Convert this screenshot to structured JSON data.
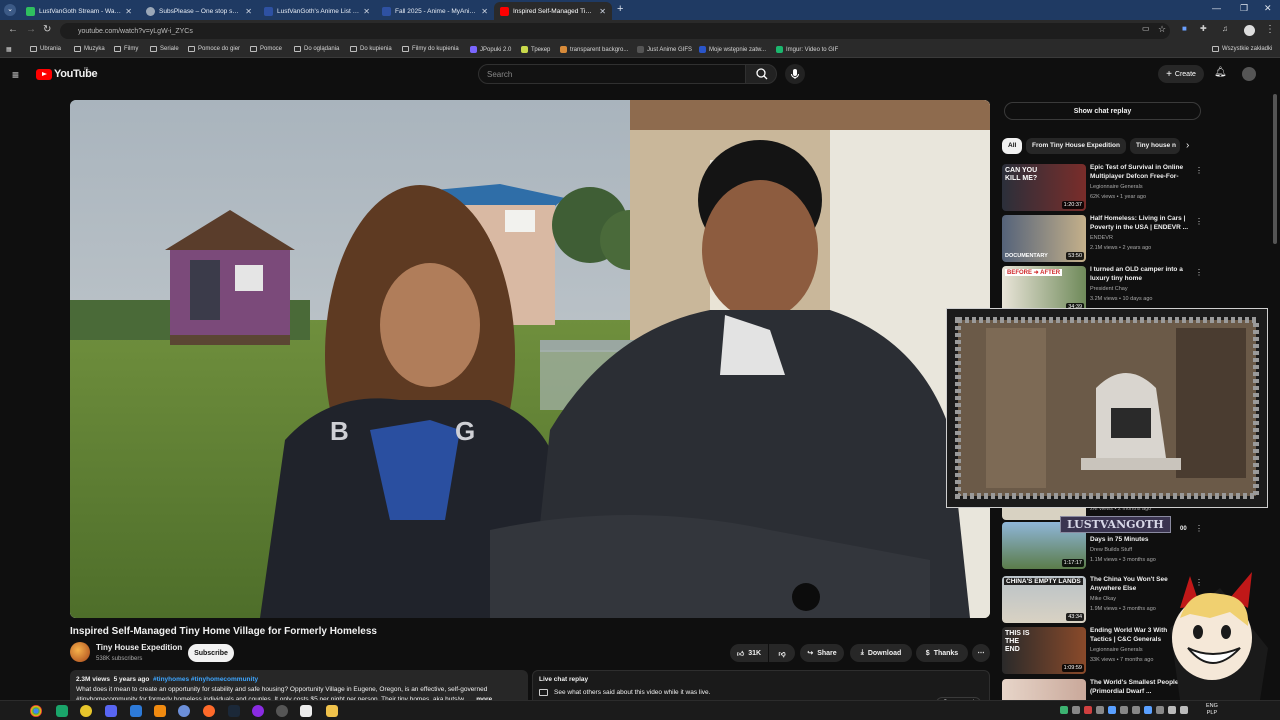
{
  "browser": {
    "tabs": [
      {
        "label": "LustVanGoth Stream - Watch L",
        "active": false,
        "favicon_color": "#2fbf5f"
      },
      {
        "label": "SubsPlease – One stop shop fo",
        "active": false,
        "favicon_color": "#9aa7b7"
      },
      {
        "label": "LustVanGoth's Anime List - My",
        "active": false,
        "favicon_color": "#2e51a2"
      },
      {
        "label": "Fall 2025 - Anime - MyAnimeL",
        "active": false,
        "favicon_color": "#2e51a2"
      },
      {
        "label": "Inspired Self-Managed Tiny Ho",
        "active": true,
        "favicon_color": "#ff0000"
      }
    ],
    "new_tab": "+",
    "url": "youtube.com/watch?v=yLgW-i_ZYCs",
    "bookmarks": [
      "Ubrania",
      "Muzyka",
      "Filmy",
      "Seriale",
      "Pomoce do gier",
      "Pomoce",
      "Do oglądania",
      "Do kupienia",
      "Filmy do kupienia",
      "JPopuki 2.0",
      "Трекер",
      "transparent backgro...",
      "Just Anime GIFS",
      "Moje wstępnie zatw...",
      "Imgur: Video to GIF"
    ],
    "all_bookmarks": "Wszystkie zakładki"
  },
  "youtube": {
    "logo_text": "YouTube",
    "region": "PL",
    "search_placeholder": "Search",
    "create_label": "Create",
    "video": {
      "title": "Inspired Self-Managed Tiny Home Village for Formerly Homeless",
      "channel": "Tiny House Expedition",
      "subscribers": "538K subscribers",
      "subscribe_label": "Subscribe",
      "likes": "31K",
      "share_label": "Share",
      "download_label": "Download",
      "thanks_label": "Thanks",
      "views": "2.3M views",
      "age": "5 years ago",
      "tags": "#tinyhomes #tinyhomecommunity",
      "description_line1": "What does it mean to create an opportunity for stability and safe housing? Opportunity Village in Eugene, Oregon, is an effective, self-governed",
      "description_line2": "#tinyhomecommunity for formerly homeless individuals and couples. It only costs $5 per night per person. Their tiny homes, aka huts/w...",
      "more_label": "...more"
    },
    "live_chat": {
      "title": "Live chat replay",
      "subtitle": "See what others said about this video while it was live.",
      "open_panel": "Open panel"
    },
    "show_chat_replay": "Show chat replay",
    "chips": [
      "All",
      "From Tiny House Expedition",
      "Tiny house n"
    ],
    "recommendations": [
      {
        "title": "Epic Test of Survival in Online Multiplayer Defcon Free-For-Al...",
        "channel": "Legionnaire Generals",
        "meta": "62K views • 1 year ago",
        "duration": "1:20:37",
        "thumb_text": "CAN YOU KILL ME?"
      },
      {
        "title": "Half Homeless: Living in Cars | Poverty in the USA | ENDEVR ...",
        "channel": "ENDEVR",
        "meta": "2.1M views • 2 years ago",
        "duration": "53:50",
        "thumb_text": "DOCUMENTARY"
      },
      {
        "title": "I turned an OLD camper into a luxury tiny home",
        "channel": "President Chay",
        "meta": "3.2M views • 10 days ago",
        "duration": "34:39",
        "thumb_text": "BEFORE ➜ AFTER"
      },
      {
        "title": "Days in 75 Minutes",
        "channel": "Drew Builds Stuff",
        "meta": "1.1M views • 3 months ago",
        "duration": "1:17:17",
        "thumb_text": ""
      },
      {
        "title": "The China You Won't See Anywhere Else",
        "channel": "Mike Okay",
        "meta": "1.9M views • 3 months ago",
        "duration": "43:34",
        "thumb_text": "CHINA'S EMPTY LANDS"
      },
      {
        "title": "Ending World War 3 With Tactics | C&C Generals",
        "channel": "Legionnaire Generals",
        "meta": "33K views • 7 months ago",
        "duration": "1:09:59",
        "thumb_text": "THIS IS THE END"
      },
      {
        "title": "The World's Smallest People (Primordial Dwarf ...",
        "channel": "",
        "meta": "",
        "duration": "",
        "thumb_text": ""
      }
    ],
    "partial_rec_meta": "2M views • 2 months ago",
    "partial_rec_duration": "00"
  },
  "overlay": {
    "streamer_tag": "LUSTVANGOTH"
  },
  "taskbar": {
    "lang": "ENG",
    "layout": "PLP"
  }
}
